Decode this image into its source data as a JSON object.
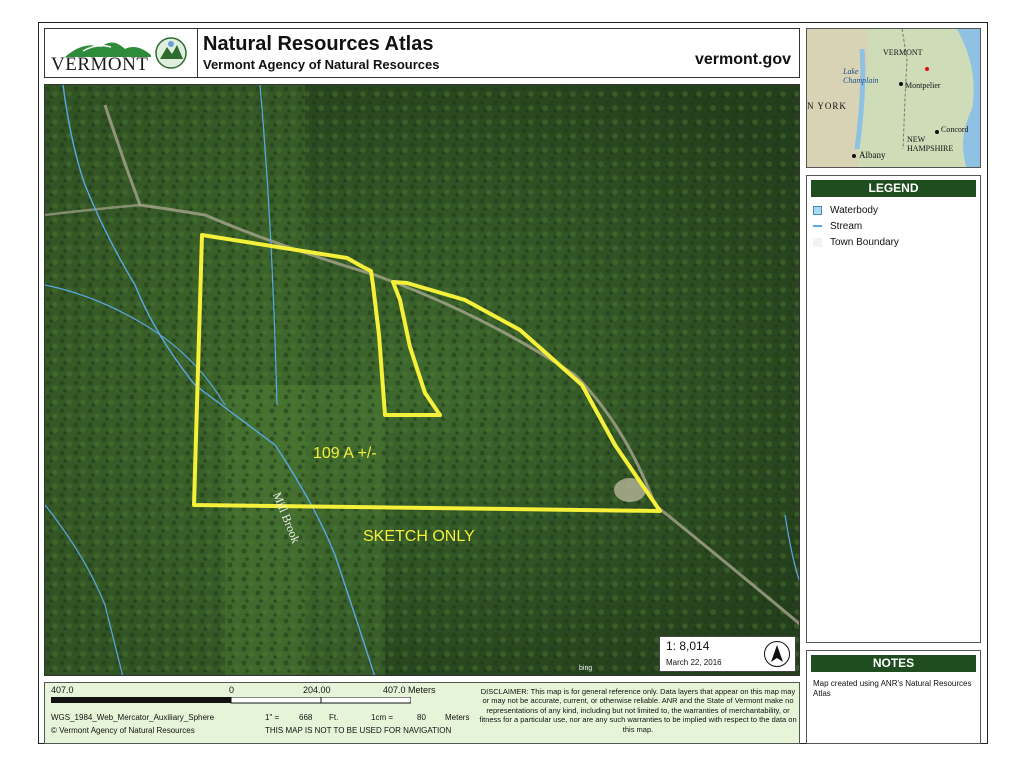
{
  "header": {
    "logo_text": "VERMONT",
    "title": "Natural Resources Atlas",
    "subtitle": "Vermont Agency of Natural Resources",
    "site": "vermont.gov"
  },
  "map": {
    "parcel_label": "109 A +/-",
    "sketch_label": "SKETCH ONLY",
    "brook_label": "Mill Brook",
    "attribution": "bing",
    "colors": {
      "parcel_outline": "#f5f03a",
      "stream": "#5aa9e6",
      "forest": "#2b4a22"
    }
  },
  "scale": {
    "ratio": "1:  8,014",
    "date": "March 22, 2016"
  },
  "inset": {
    "labels": [
      "VERMONT",
      "Lake Champlain",
      "Montpelier",
      "N YORK",
      "NEW HAMPSHIRE",
      "Concord",
      "Albany"
    ]
  },
  "legend": {
    "title": "LEGEND",
    "items": [
      {
        "label": "Waterbody",
        "swatch": "#a9d8f0"
      },
      {
        "label": "Stream",
        "swatch": "#5aa9e6"
      },
      {
        "label": "Town Boundary",
        "swatch": "#eeeeee"
      }
    ]
  },
  "notes": {
    "title": "NOTES",
    "text": "Map created using ANR's Natural Resources Atlas"
  },
  "bottom": {
    "bar_left": "407.0",
    "bar_zero": "0",
    "bar_mid": "204.00",
    "bar_right": "407.0 Meters",
    "projection": "WGS_1984_Web_Mercator_Auxiliary_Sphere",
    "inch_label": "1\" =",
    "inch_value": "668",
    "inch_unit": "Ft.",
    "cm_label": "1cm =",
    "cm_value": "80",
    "cm_unit": "Meters",
    "copyright": "© Vermont Agency of Natural Resources",
    "navigation": "THIS MAP IS NOT TO BE USED FOR NAVIGATION",
    "disclaimer": "DISCLAIMER: This map is for general reference only. Data layers that appear on this map may or may not be accurate, current, or otherwise reliable. ANR and the State of Vermont make no representations of any kind, including but not limited to, the warranties of merchantability, or fitness for a particular use, nor are any such warranties to be implied with respect to the data on this map."
  }
}
